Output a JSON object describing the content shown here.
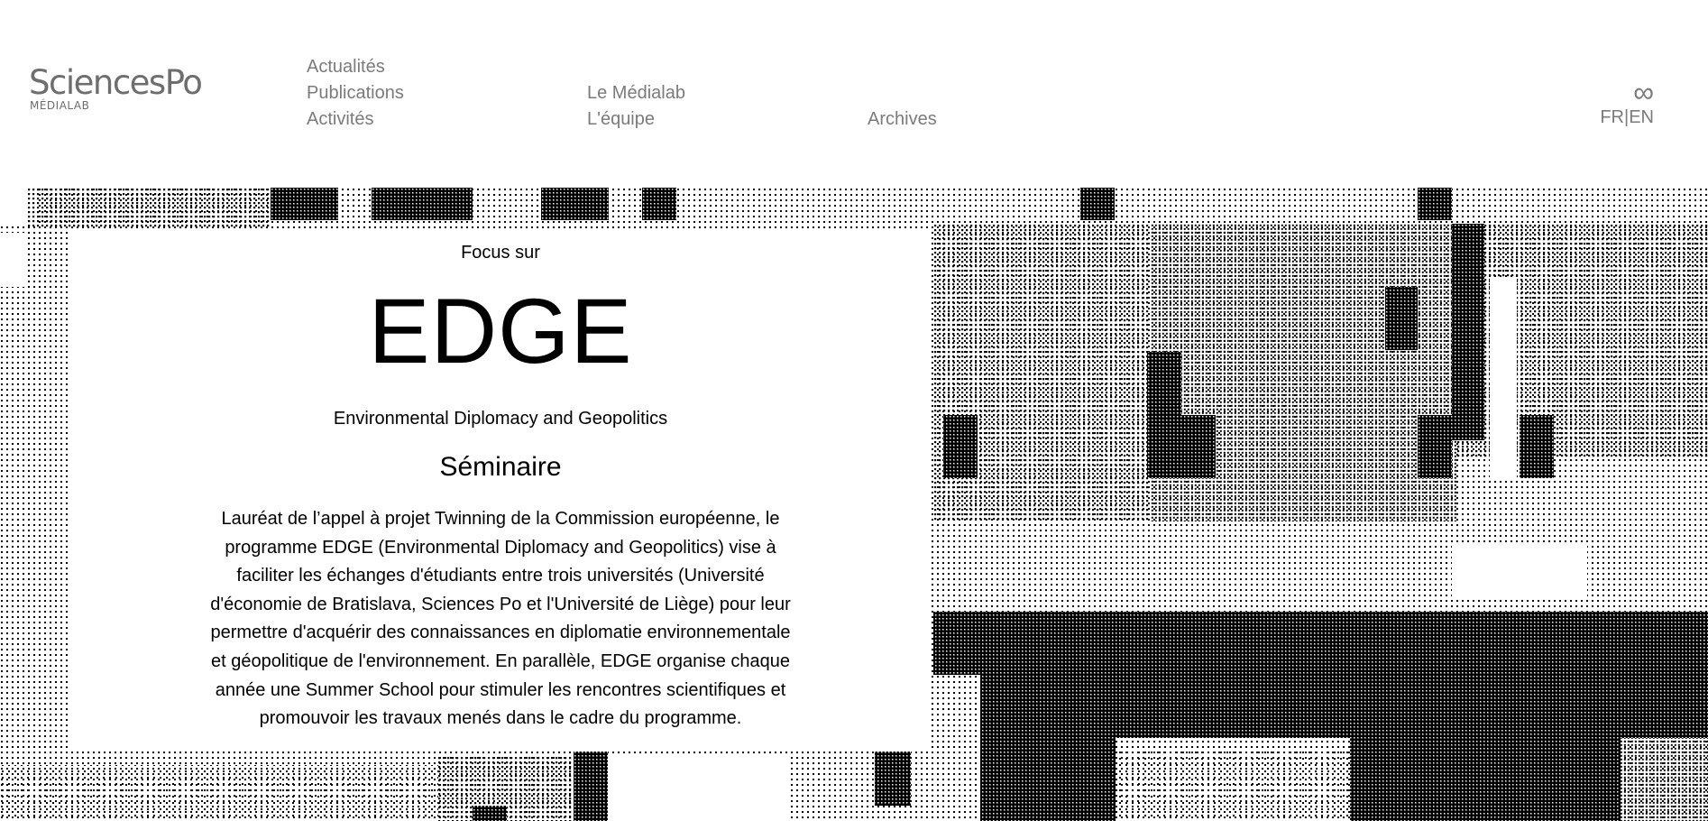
{
  "logo": {
    "name": "SciencesPo",
    "sub": "MÉDIALAB"
  },
  "nav": {
    "col1": [
      "Actualités",
      "Publications",
      "Activités"
    ],
    "col2": [
      "Le Médialab",
      "L'équipe"
    ],
    "col3": [
      "Archives"
    ]
  },
  "lang": {
    "icon": "infinity-icon",
    "fr": "FR",
    "separator": "|",
    "en": "EN"
  },
  "focus": {
    "label": "Focus sur",
    "title": "EDGE",
    "subtitle": "Environmental Diplomacy and Geopolitics",
    "type": "Séminaire",
    "description": "Lauréat de l’appel à projet Twinning de la Commission européenne, le programme EDGE (Environmental Diplomacy and Geopolitics) vise à faciliter les échanges d'étudiants entre trois universités (Université d'économie de Bratislava, Sciences Po et l'Université de Liège) pour leur permettre d'acquérir des connaissances en diplomatie environnementale et géopolitique de l'environnement. En parallèle, EDGE organise chaque année une Summer School pour stimuler les rencontres scientifiques et promouvoir les travaux menés dans le cadre du programme."
  },
  "colors": {
    "nav_text": "#7b7b7b",
    "logo": "#6e6e6e",
    "pattern": "#000000",
    "background": "#ffffff"
  }
}
